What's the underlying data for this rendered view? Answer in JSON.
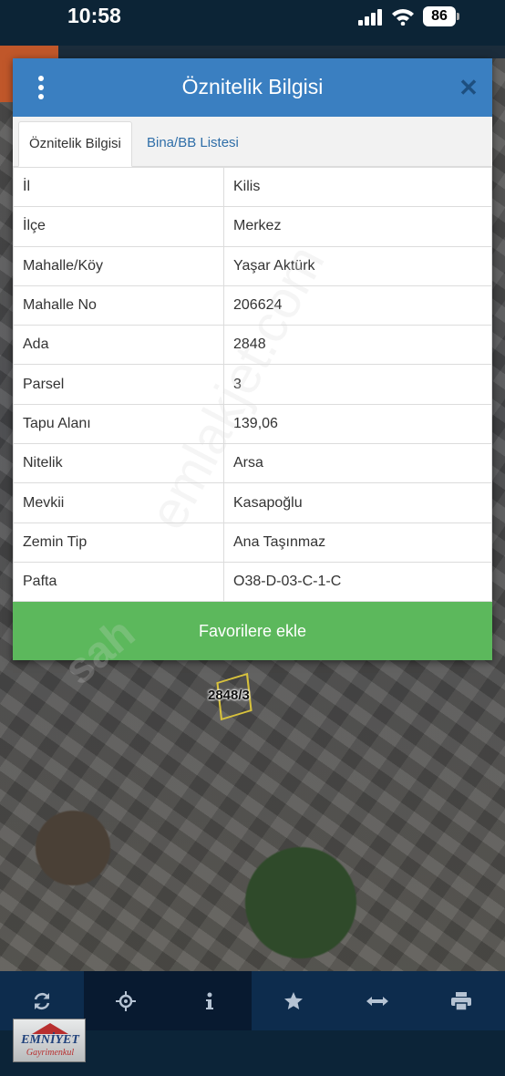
{
  "status_bar": {
    "time": "10:58",
    "battery": "86"
  },
  "dialog": {
    "title": "Öznitelik Bilgisi",
    "tabs": [
      {
        "label": "Öznitelik Bilgisi",
        "active": true
      },
      {
        "label": "Bina/BB Listesi",
        "active": false
      }
    ],
    "rows": [
      {
        "key": "İl",
        "value": "Kilis"
      },
      {
        "key": "İlçe",
        "value": "Merkez"
      },
      {
        "key": "Mahalle/Köy",
        "value": "Yaşar Aktürk"
      },
      {
        "key": "Mahalle No",
        "value": "206624"
      },
      {
        "key": "Ada",
        "value": "2848"
      },
      {
        "key": "Parsel",
        "value": "3"
      },
      {
        "key": "Tapu Alanı",
        "value": "139,06"
      },
      {
        "key": "Nitelik",
        "value": "Arsa"
      },
      {
        "key": "Mevkii",
        "value": "Kasapoğlu"
      },
      {
        "key": "Zemin Tip",
        "value": "Ana Taşınmaz"
      },
      {
        "key": "Pafta",
        "value": "O38-D-03-C-1-C"
      }
    ],
    "favorite_button": "Favorilere ekle"
  },
  "map": {
    "parcel_label": "2848/3"
  },
  "watermark": {
    "line1": "emlakjet.com",
    "line2": "sah"
  },
  "toolbar": {
    "buttons": [
      {
        "icon": "refresh-icon"
      },
      {
        "icon": "locate-icon"
      },
      {
        "icon": "info-icon"
      },
      {
        "icon": "star-icon"
      },
      {
        "icon": "measure-icon"
      },
      {
        "icon": "print-icon"
      }
    ]
  },
  "logo": {
    "main": "EMNİYET",
    "sub": "Gayrimenkul"
  },
  "colors": {
    "header": "#3a7fc1",
    "favorite": "#5cb85c",
    "toolbar": "#0d2c4d",
    "tab_link": "#2f6ea8"
  }
}
